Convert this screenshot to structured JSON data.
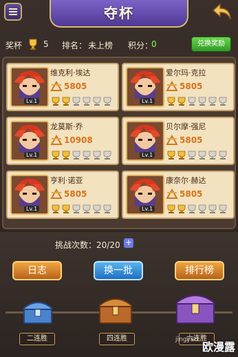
{
  "header": {
    "title": "夺杯"
  },
  "stats": {
    "cups_label": "奖杯",
    "cups_value": "5",
    "rank_label": "排名：",
    "rank_value": "未上榜",
    "points_label": "积分：",
    "points_value": "0",
    "exchange_button": "兑换奖励"
  },
  "opponents": [
    {
      "name": "维克利·埃达",
      "score": "5805",
      "level": "Lv.1",
      "cups_won": 2
    },
    {
      "name": "爱尔玛·克拉",
      "score": "5805",
      "level": "Lv.1",
      "cups_won": 2
    },
    {
      "name": "龙莫斯·乔",
      "score": "10908",
      "level": "Lv.1",
      "cups_won": 2
    },
    {
      "name": "贝尔摩·强尼",
      "score": "5805",
      "level": "Lv.1",
      "cups_won": 2
    },
    {
      "name": "亨利·诺亚",
      "score": "5805",
      "level": "Lv.1",
      "cups_won": 2
    },
    {
      "name": "康奈尔·赫达",
      "score": "5805",
      "level": "Lv.1",
      "cups_won": 2
    }
  ],
  "cups_total": 6,
  "challenge": {
    "label": "挑战次数：20/20",
    "plus": "+"
  },
  "buttons": {
    "log": "日志",
    "refresh": "换一批",
    "ranking": "排行榜"
  },
  "chests": [
    {
      "label": "二连胜",
      "color": "#5d8fd8"
    },
    {
      "label": "四连胜",
      "color": "#c8742e"
    },
    {
      "label": "六连胜",
      "color": "#9a5fc8"
    }
  ],
  "watermark": {
    "main": "欧漫露",
    "sub": "jingyan"
  }
}
